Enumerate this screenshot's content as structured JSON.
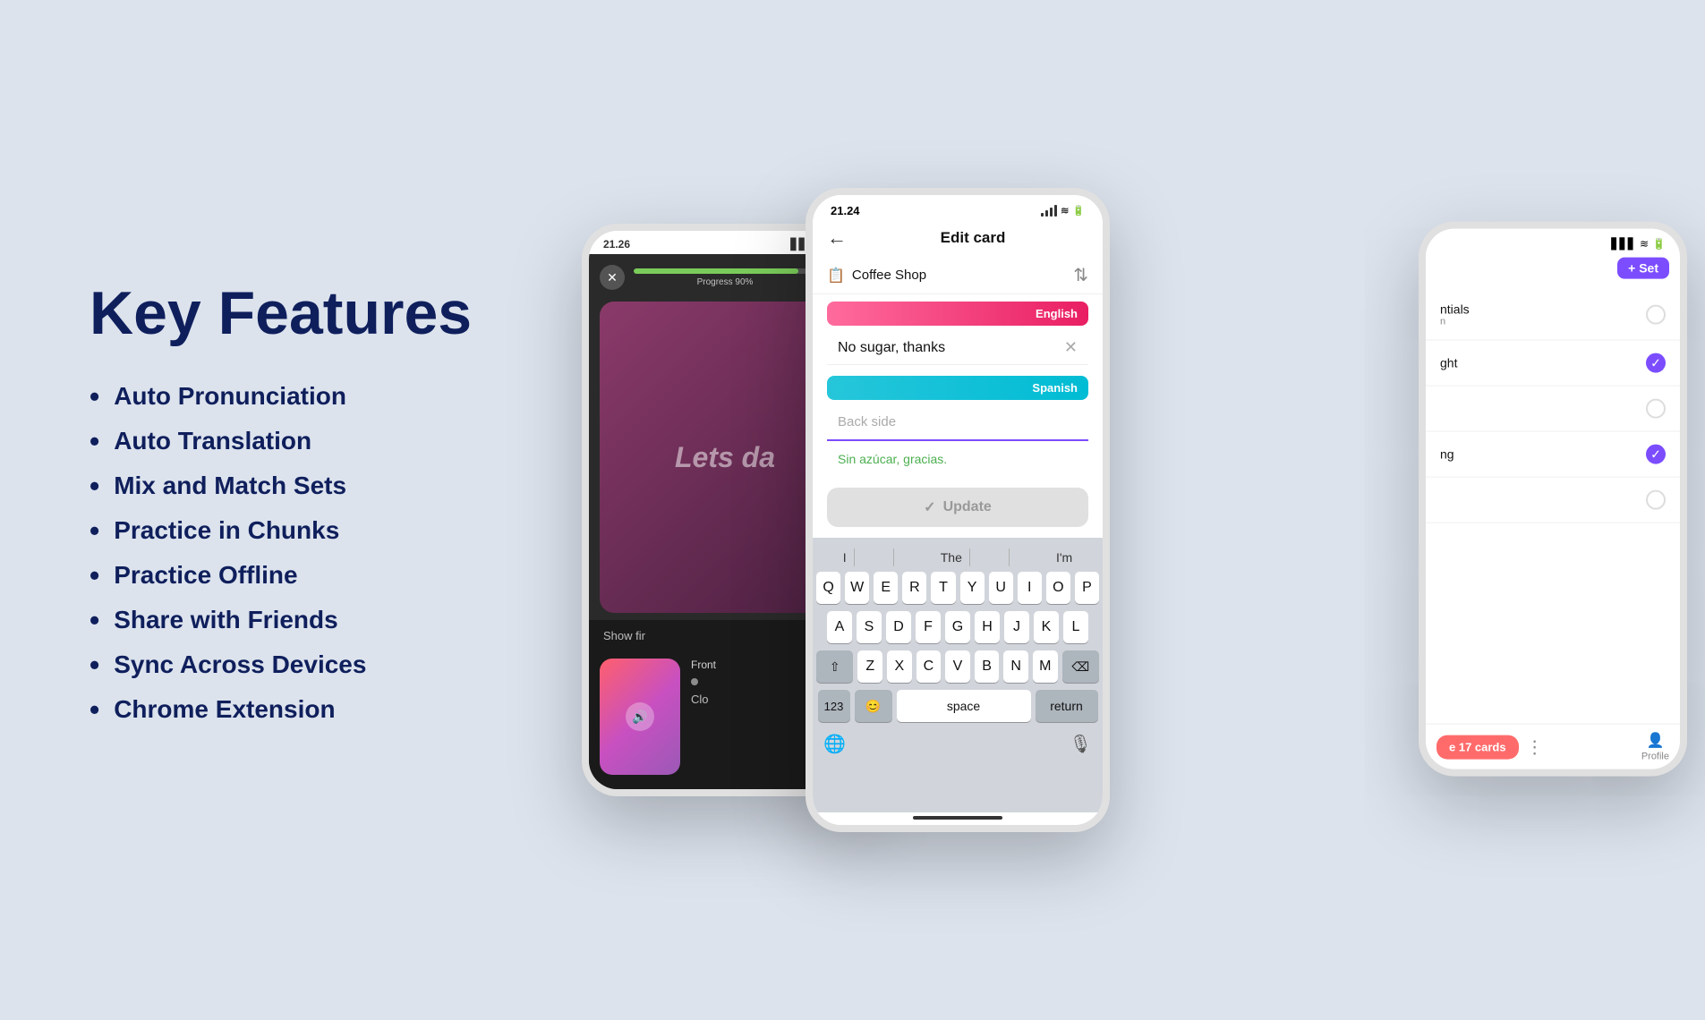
{
  "page": {
    "bg_color": "#dce3ed",
    "title": "Key Features"
  },
  "features": {
    "heading": "Key Features",
    "items": [
      "Auto Pronunciation",
      "Auto Translation",
      "Mix and Match Sets",
      "Practice in Chunks",
      "Practice Offline",
      "Share with Friends",
      "Sync Across Devices",
      "Chrome Extension"
    ]
  },
  "phone_left": {
    "time": "21.26",
    "progress_text": "Progress 90%",
    "progress_pct": 90,
    "card_text": "Lets da",
    "show_first": "Show fir",
    "front_label": "Front",
    "close_label": "Clo"
  },
  "phone_middle": {
    "time": "21.24",
    "header_title": "Edit card",
    "deck_name": "Coffee Shop",
    "english_label": "English",
    "input_text": "No sugar, thanks",
    "spanish_label": "Spanish",
    "back_side_placeholder": "Back side",
    "translation": "Sin azúcar, gracias.",
    "update_label": "Update",
    "keyboard": {
      "suggestions": [
        "I",
        "The",
        "I'm"
      ],
      "rows": [
        [
          "Q",
          "W",
          "E",
          "R",
          "T",
          "Y",
          "U",
          "I",
          "O",
          "P"
        ],
        [
          "A",
          "S",
          "D",
          "F",
          "G",
          "H",
          "J",
          "K",
          "L"
        ],
        [
          "⇧",
          "Z",
          "X",
          "C",
          "V",
          "B",
          "N",
          "M",
          "⌫"
        ],
        [
          "123",
          "😊",
          "space",
          "return"
        ]
      ]
    }
  },
  "phone_right": {
    "set_label": "+ Set",
    "items": [
      {
        "text": "ntials",
        "sub": "n",
        "checked": false
      },
      {
        "text": "ght",
        "sub": "",
        "checked": true
      },
      {
        "text": "",
        "sub": "",
        "checked": false
      },
      {
        "text": "ng",
        "sub": "",
        "checked": true
      },
      {
        "text": "",
        "sub": "",
        "checked": false
      }
    ],
    "cards_label": "e 17 cards",
    "profile_label": "Profile"
  }
}
